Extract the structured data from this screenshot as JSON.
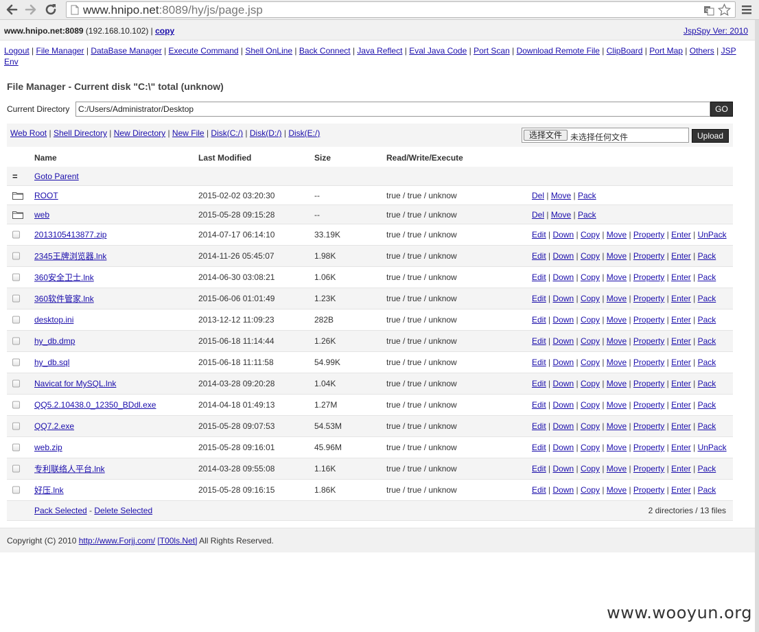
{
  "browser": {
    "url_host": "www.hnipo.net",
    "url_path": ":8089/hy/js/page.jsp"
  },
  "topbar": {
    "host": "www.hnipo.net:8089",
    "ip": " (192.168.10.102) | ",
    "copy_label": "copy",
    "version": "JspSpy Ver: 2010"
  },
  "menu": {
    "items": [
      "Logout",
      "File Manager",
      "DataBase Manager",
      "Execute Command",
      "Shell OnLine",
      "Back Connect",
      "Java Reflect",
      "Eval Java Code",
      "Port Scan",
      "Download Remote File",
      "ClipBoard",
      "Port Map",
      "Others",
      "JSP Env"
    ]
  },
  "title": "File Manager - Current disk \"C:\\\" total (unknow)",
  "current_dir": {
    "label": "Current Directory",
    "value": "C:/Users/Administrator/Desktop",
    "go_label": "GO"
  },
  "quicklinks": [
    "Web Root",
    "Shell Directory",
    "New Directory",
    "New File",
    "Disk(C:/)",
    "Disk(D:/)",
    "Disk(E:/)"
  ],
  "upload": {
    "choose_label": "选择文件",
    "no_file_label": "未选择任何文件",
    "upload_label": "Upload"
  },
  "table": {
    "headers": {
      "name": "Name",
      "modified": "Last Modified",
      "size": "Size",
      "rwe": "Read/Write/Execute"
    },
    "parent": {
      "symbol": "=",
      "label": "Goto Parent"
    },
    "dirs": [
      {
        "name": "ROOT",
        "modified": "2015-02-02 03:20:30",
        "size": "--",
        "rwe": "true / true / unknow",
        "actions": [
          "Del",
          "Move",
          "Pack"
        ]
      },
      {
        "name": "web",
        "modified": "2015-05-28 09:15:28",
        "size": "--",
        "rwe": "true / true / unknow",
        "actions": [
          "Del",
          "Move",
          "Pack"
        ]
      }
    ],
    "files": [
      {
        "name": "2013105413877.zip",
        "modified": "2014-07-17 06:14:10",
        "size": "33.19K",
        "rwe": "true / true / unknow",
        "actions": [
          "Edit",
          "Down",
          "Copy",
          "Move",
          "Property",
          "Enter",
          "UnPack"
        ]
      },
      {
        "name": "2345王牌浏览器.lnk",
        "modified": "2014-11-26 05:45:07",
        "size": "1.98K",
        "rwe": "true / true / unknow",
        "actions": [
          "Edit",
          "Down",
          "Copy",
          "Move",
          "Property",
          "Enter",
          "Pack"
        ]
      },
      {
        "name": "360安全卫士.lnk",
        "modified": "2014-06-30 03:08:21",
        "size": "1.06K",
        "rwe": "true / true / unknow",
        "actions": [
          "Edit",
          "Down",
          "Copy",
          "Move",
          "Property",
          "Enter",
          "Pack"
        ]
      },
      {
        "name": "360软件管家.lnk",
        "modified": "2015-06-06 01:01:49",
        "size": "1.23K",
        "rwe": "true / true / unknow",
        "actions": [
          "Edit",
          "Down",
          "Copy",
          "Move",
          "Property",
          "Enter",
          "Pack"
        ]
      },
      {
        "name": "desktop.ini",
        "modified": "2013-12-12 11:09:23",
        "size": "282B",
        "rwe": "true / true / unknow",
        "actions": [
          "Edit",
          "Down",
          "Copy",
          "Move",
          "Property",
          "Enter",
          "Pack"
        ]
      },
      {
        "name": "hy_db.dmp",
        "modified": "2015-06-18 11:14:44",
        "size": "1.26K",
        "rwe": "true / true / unknow",
        "actions": [
          "Edit",
          "Down",
          "Copy",
          "Move",
          "Property",
          "Enter",
          "Pack"
        ]
      },
      {
        "name": "hy_db.sql",
        "modified": "2015-06-18 11:11:58",
        "size": "54.99K",
        "rwe": "true / true / unknow",
        "actions": [
          "Edit",
          "Down",
          "Copy",
          "Move",
          "Property",
          "Enter",
          "Pack"
        ]
      },
      {
        "name": "Navicat for MySQL.lnk",
        "modified": "2014-03-28 09:20:28",
        "size": "1.04K",
        "rwe": "true / true / unknow",
        "actions": [
          "Edit",
          "Down",
          "Copy",
          "Move",
          "Property",
          "Enter",
          "Pack"
        ]
      },
      {
        "name": "QQ5.2.10438.0_12350_BDdl.exe",
        "modified": "2014-04-18 01:49:13",
        "size": "1.27M",
        "rwe": "true / true / unknow",
        "actions": [
          "Edit",
          "Down",
          "Copy",
          "Move",
          "Property",
          "Enter",
          "Pack"
        ]
      },
      {
        "name": "QQ7.2.exe",
        "modified": "2015-05-28 09:07:53",
        "size": "54.53M",
        "rwe": "true / true / unknow",
        "actions": [
          "Edit",
          "Down",
          "Copy",
          "Move",
          "Property",
          "Enter",
          "Pack"
        ]
      },
      {
        "name": "web.zip",
        "modified": "2015-05-28 09:16:01",
        "size": "45.96M",
        "rwe": "true / true / unknow",
        "actions": [
          "Edit",
          "Down",
          "Copy",
          "Move",
          "Property",
          "Enter",
          "UnPack"
        ]
      },
      {
        "name": "专利联络人平台.lnk",
        "modified": "2014-03-28 09:55:08",
        "size": "1.16K",
        "rwe": "true / true / unknow",
        "actions": [
          "Edit",
          "Down",
          "Copy",
          "Move",
          "Property",
          "Enter",
          "Pack"
        ]
      },
      {
        "name": "好压.lnk",
        "modified": "2015-05-28 09:16:15",
        "size": "1.86K",
        "rwe": "true / true / unknow",
        "actions": [
          "Edit",
          "Down",
          "Copy",
          "Move",
          "Property",
          "Enter",
          "Pack"
        ]
      }
    ],
    "footer": {
      "pack_selected": "Pack Selected",
      "separator": " - ",
      "delete_selected": "Delete Selected",
      "summary": "2 directories / 13 files"
    }
  },
  "copyright": {
    "prefix": "Copyright (C) 2010 ",
    "link1": "http://www.Forjj.com/",
    "mid": "  ",
    "link2": "[T00ls.Net]",
    "suffix": " All Rights Reserved."
  },
  "watermark": "www.wooyun.org",
  "icons": {
    "back": "arrow-left",
    "forward": "arrow-right",
    "reload": "reload",
    "page": "page",
    "translate": "translate",
    "star": "star",
    "menu": "hamburger",
    "folder": "folder",
    "checkbox": "checkbox"
  }
}
